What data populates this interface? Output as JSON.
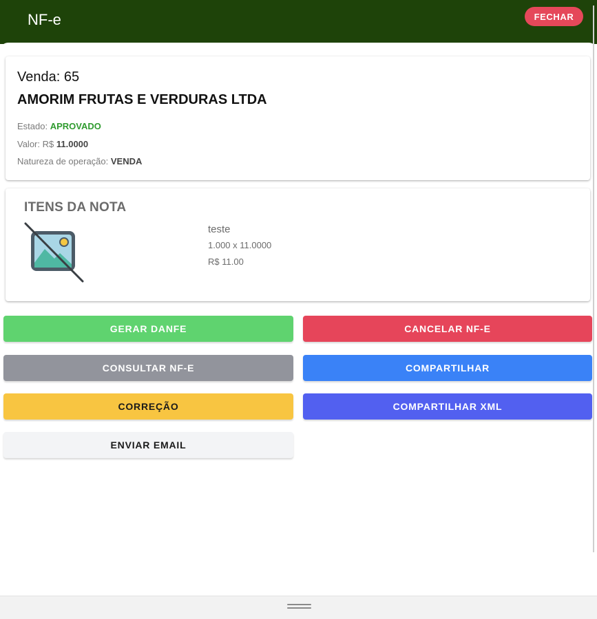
{
  "header": {
    "title": "NF-e",
    "close_label": "FECHAR",
    "background": "#1e4309",
    "close_color": "#e5485a"
  },
  "sale": {
    "number_label": "Venda: 65",
    "customer": "AMORIM FRUTAS E VERDURAS LTDA",
    "status_label": "Estado:",
    "status_value": "APROVADO",
    "value_label": "Valor: R$",
    "value_amount": "11.0000",
    "operation_label": "Natureza de operação:",
    "operation_value": "VENDA"
  },
  "items": {
    "title": "ITENS DA NOTA",
    "list": [
      {
        "name": "teste",
        "quantity_line": "1.000 x 11.0000",
        "price": "R$ 11.00",
        "icon": "no-image-icon"
      }
    ]
  },
  "actions": {
    "gerar_danfe": {
      "label": "GERAR DANFE",
      "color": "#5fd36f",
      "text_color": "#ffffff"
    },
    "cancelar_nfe": {
      "label": "CANCELAR NF-E",
      "color": "#e6455a",
      "text_color": "#ffffff"
    },
    "consultar_nfe": {
      "label": "CONSULTAR NF-E",
      "color": "#92949c",
      "text_color": "#ffffff"
    },
    "compartilhar": {
      "label": "COMPARTILHAR",
      "color": "#3a82f7",
      "text_color": "#ffffff"
    },
    "correcao": {
      "label": "CORREÇÃO",
      "color": "#f8c541",
      "text_color": "#1a1a1a"
    },
    "compartilhar_xml": {
      "label": "COMPARTILHAR XML",
      "color": "#5260f0",
      "text_color": "#ffffff"
    },
    "enviar_email": {
      "label": "ENVIAR EMAIL",
      "color": "#f3f4f6",
      "text_color": "#1a1a1a"
    }
  }
}
